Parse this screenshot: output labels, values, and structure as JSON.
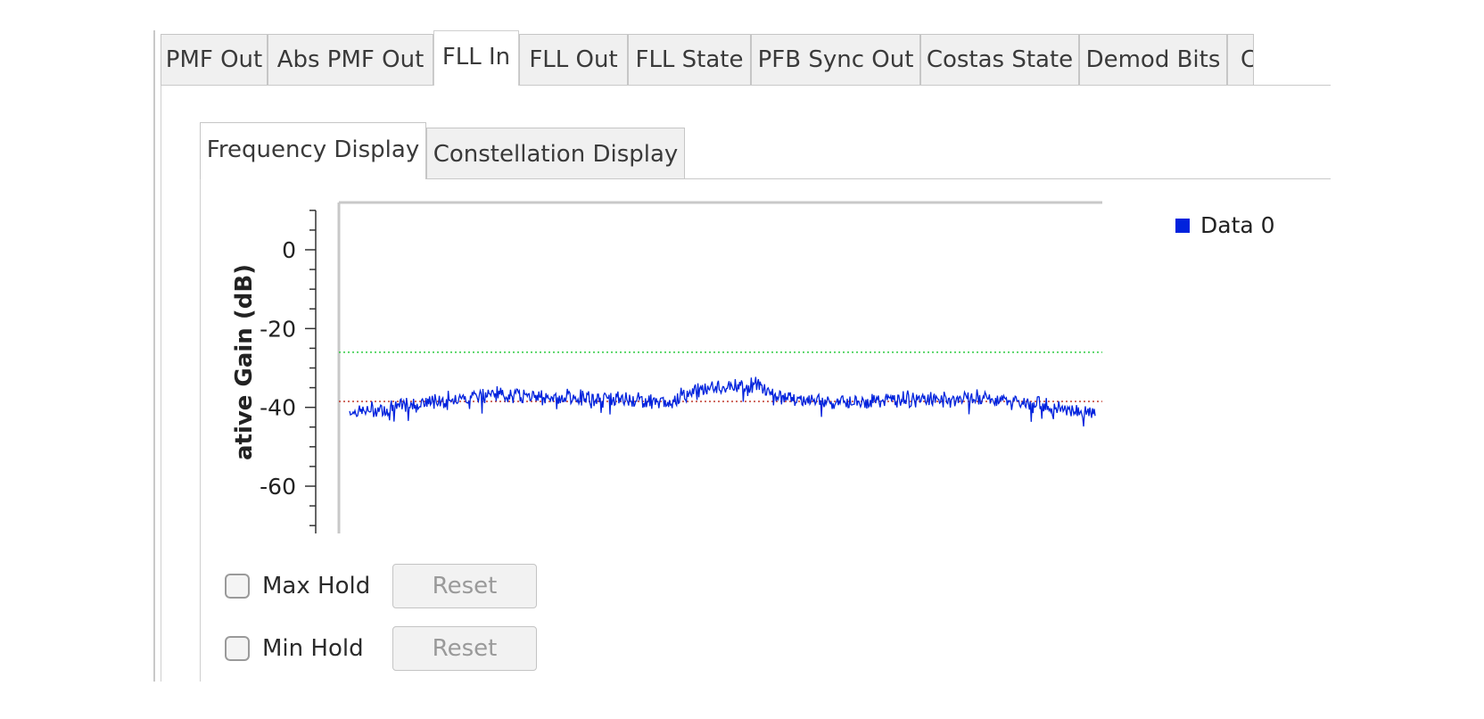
{
  "main_tabs": [
    {
      "label": "PMF Out"
    },
    {
      "label": "Abs PMF Out"
    },
    {
      "label": "FLL In"
    },
    {
      "label": "FLL Out"
    },
    {
      "label": "FLL State"
    },
    {
      "label": "PFB Sync Out"
    },
    {
      "label": "Costas State"
    },
    {
      "label": "Demod Bits"
    },
    {
      "label": "C"
    }
  ],
  "active_main_tab": "FLL In",
  "sub_tabs": [
    {
      "label": "Frequency Display"
    },
    {
      "label": "Constellation Display"
    }
  ],
  "active_sub_tab": "Frequency Display",
  "controls": {
    "max_hold_label": "Max Hold",
    "min_hold_label": "Min Hold",
    "reset_label": "Reset",
    "max_hold_checked": false,
    "min_hold_checked": false
  },
  "chart_data": {
    "type": "line",
    "ylabel": "ative Gain (dB)",
    "yticks": [
      "0",
      "-20",
      "-40",
      "-60"
    ],
    "ylim": [
      -72,
      12
    ],
    "legend": [
      "Data 0"
    ],
    "legend_placement": "top-right",
    "series": [
      {
        "name": "Data 0",
        "color": "#0022dd",
        "shape_db": [
          -41,
          -41,
          -40.5,
          -40,
          -39.5,
          -39,
          -38.5,
          -38,
          -37.5,
          -37,
          -36.5,
          -36.5,
          -37,
          -37,
          -37.5,
          -37.5,
          -37.5,
          -37.5,
          -38,
          -38,
          -38,
          -38,
          -38.5,
          -38.5,
          -37,
          -35.5,
          -35,
          -35,
          -34.5,
          -34,
          -35,
          -37,
          -38,
          -38.5,
          -38.5,
          -38.5,
          -38.5,
          -38.5,
          -38.5,
          -38,
          -38,
          -38,
          -38,
          -38,
          -38,
          -37.5,
          -37.5,
          -38,
          -38.5,
          -39,
          -39.5,
          -40,
          -40.5,
          -41,
          -41.5
        ]
      }
    ],
    "reference_lines": [
      {
        "kind": "max",
        "color": "#2ecc40",
        "value": -26
      },
      {
        "kind": "min",
        "color": "#c0392b",
        "value": -38.5
      }
    ],
    "colors": {
      "trace": "#0022dd",
      "grid_max": "#2ecc40",
      "grid_min": "#c0392b"
    }
  }
}
